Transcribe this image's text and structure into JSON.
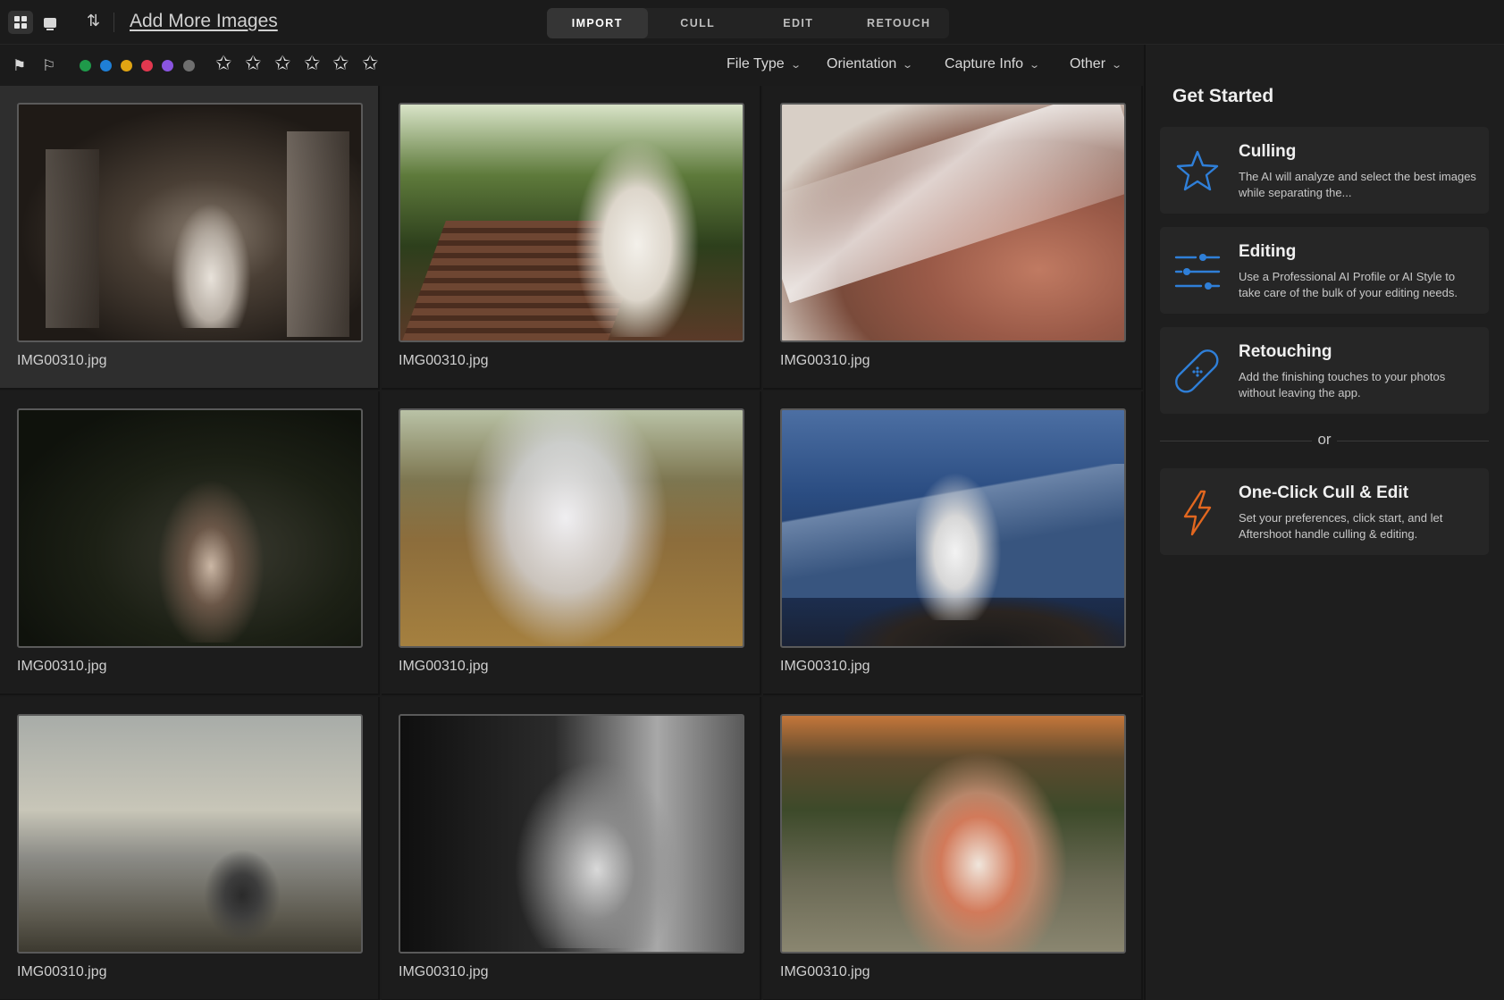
{
  "toolbar": {
    "add_more_label": "Add More Images",
    "modes": [
      {
        "label": "IMPORT",
        "active": true
      },
      {
        "label": "CULL",
        "active": false
      },
      {
        "label": "EDIT",
        "active": false
      },
      {
        "label": "RETOUCH",
        "active": false
      }
    ]
  },
  "filters": {
    "color_labels": [
      "#1f9a4a",
      "#1f7fd6",
      "#e0a413",
      "#e2384f",
      "#8a54e0",
      "#6f6f6f"
    ],
    "star_count": 6,
    "dropdowns": [
      {
        "label": "File Type"
      },
      {
        "label": "Orientation"
      },
      {
        "label": "Capture Info"
      },
      {
        "label": "Other"
      }
    ]
  },
  "grid": {
    "images": [
      {
        "filename": "IMG00310.jpg",
        "selected": true
      },
      {
        "filename": "IMG00310.jpg",
        "selected": false
      },
      {
        "filename": "IMG00310.jpg",
        "selected": false
      },
      {
        "filename": "IMG00310.jpg",
        "selected": false
      },
      {
        "filename": "IMG00310.jpg",
        "selected": false
      },
      {
        "filename": "IMG00310.jpg",
        "selected": false
      },
      {
        "filename": "IMG00310.jpg",
        "selected": false
      },
      {
        "filename": "IMG00310.jpg",
        "selected": false
      },
      {
        "filename": "IMG00310.jpg",
        "selected": false
      }
    ]
  },
  "panel": {
    "title": "Get Started",
    "cards": [
      {
        "icon": "star-icon",
        "title": "Culling",
        "description": "The AI will analyze and select the best images while separating the..."
      },
      {
        "icon": "sliders-icon",
        "title": "Editing",
        "description": "Use a Professional AI Profile or AI Style to take care of the bulk of your editing needs."
      },
      {
        "icon": "bandage-icon",
        "title": "Retouching",
        "description": "Add the finishing touches to your photos without leaving the app."
      }
    ],
    "or_label": "or",
    "one_click": {
      "icon": "lightning-icon",
      "title": "One-Click Cull & Edit",
      "description": "Set your preferences, click start, and let Aftershoot handle culling & editing."
    },
    "accent_blue": "#2f7fd8",
    "accent_orange": "#e2671f"
  }
}
